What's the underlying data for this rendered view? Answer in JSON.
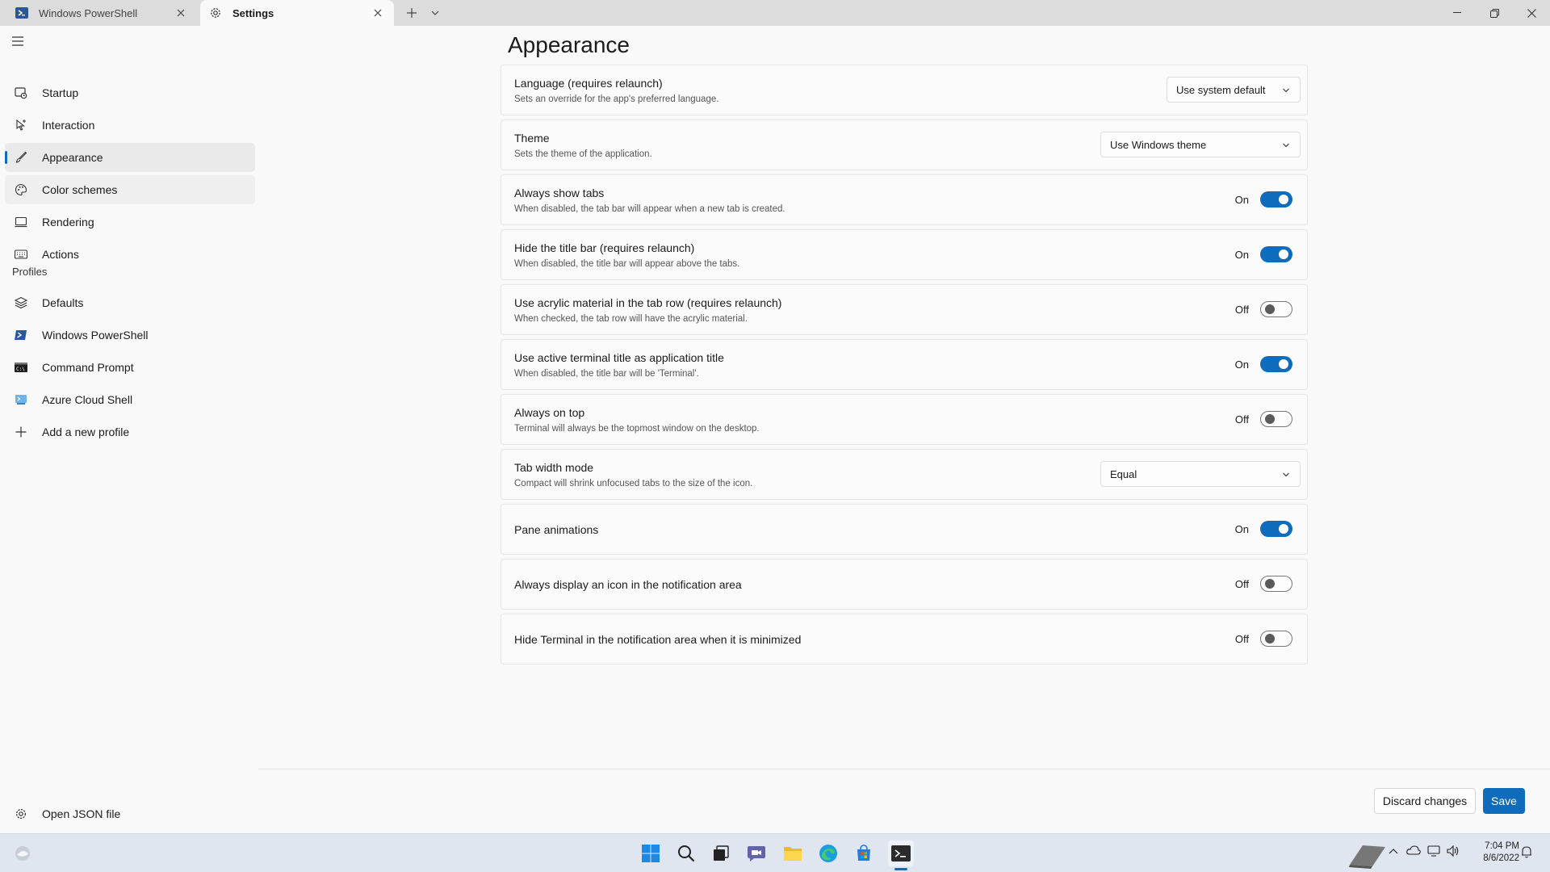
{
  "tabs": [
    {
      "label": "Windows PowerShell",
      "icon": "powershell-icon",
      "active": false
    },
    {
      "label": "Settings",
      "icon": "gear-icon",
      "active": true
    }
  ],
  "sidebar": {
    "items": [
      {
        "label": "Startup",
        "icon": "startup-icon"
      },
      {
        "label": "Interaction",
        "icon": "cursor-icon"
      },
      {
        "label": "Appearance",
        "icon": "paintbrush-icon"
      },
      {
        "label": "Color schemes",
        "icon": "palette-icon"
      },
      {
        "label": "Rendering",
        "icon": "monitor-icon"
      },
      {
        "label": "Actions",
        "icon": "keyboard-icon"
      }
    ],
    "profiles_header": "Profiles",
    "profiles": [
      {
        "label": "Defaults",
        "icon": "layers-icon"
      },
      {
        "label": "Windows PowerShell",
        "icon": "powershell-icon"
      },
      {
        "label": "Command Prompt",
        "icon": "cmd-icon"
      },
      {
        "label": "Azure Cloud Shell",
        "icon": "azure-icon"
      },
      {
        "label": "Add a new profile",
        "icon": "plus-icon"
      }
    ],
    "open_json": "Open JSON file"
  },
  "page": {
    "title": "Appearance",
    "settings": [
      {
        "title": "Language (requires relaunch)",
        "desc": "Sets an override for the app's preferred language.",
        "kind": "dropdown",
        "value": "Use system default"
      },
      {
        "title": "Theme",
        "desc": "Sets the theme of the application.",
        "kind": "dropdown",
        "value": "Use Windows theme"
      },
      {
        "title": "Always show tabs",
        "desc": "When disabled, the tab bar will appear when a new tab is created.",
        "kind": "toggle",
        "value": "On"
      },
      {
        "title": "Hide the title bar (requires relaunch)",
        "desc": "When disabled, the title bar will appear above the tabs.",
        "kind": "toggle",
        "value": "On"
      },
      {
        "title": "Use acrylic material in the tab row (requires relaunch)",
        "desc": "When checked, the tab row will have the acrylic material.",
        "kind": "toggle",
        "value": "Off"
      },
      {
        "title": "Use active terminal title as application title",
        "desc": "When disabled, the title bar will be 'Terminal'.",
        "kind": "toggle",
        "value": "On"
      },
      {
        "title": "Always on top",
        "desc": "Terminal will always be the topmost window on the desktop.",
        "kind": "toggle",
        "value": "Off"
      },
      {
        "title": "Tab width mode",
        "desc": "Compact will shrink unfocused tabs to the size of the icon.",
        "kind": "dropdown",
        "value": "Equal"
      },
      {
        "title": "Pane animations",
        "desc": "",
        "kind": "toggle",
        "value": "On"
      },
      {
        "title": "Always display an icon in the notification area",
        "desc": "",
        "kind": "toggle",
        "value": "Off"
      },
      {
        "title": "Hide Terminal in the notification area when it is minimized",
        "desc": "",
        "kind": "toggle",
        "value": "Off"
      }
    ]
  },
  "footer": {
    "discard_label": "Discard changes",
    "save_label": "Save"
  },
  "taskbar": {
    "clock_time": "7:04 PM",
    "clock_date": "8/6/2022"
  },
  "colors": {
    "accent": "#0f6cbd",
    "window_bg": "#f9f9f9",
    "taskbar_bg": "#dfe6f0"
  }
}
